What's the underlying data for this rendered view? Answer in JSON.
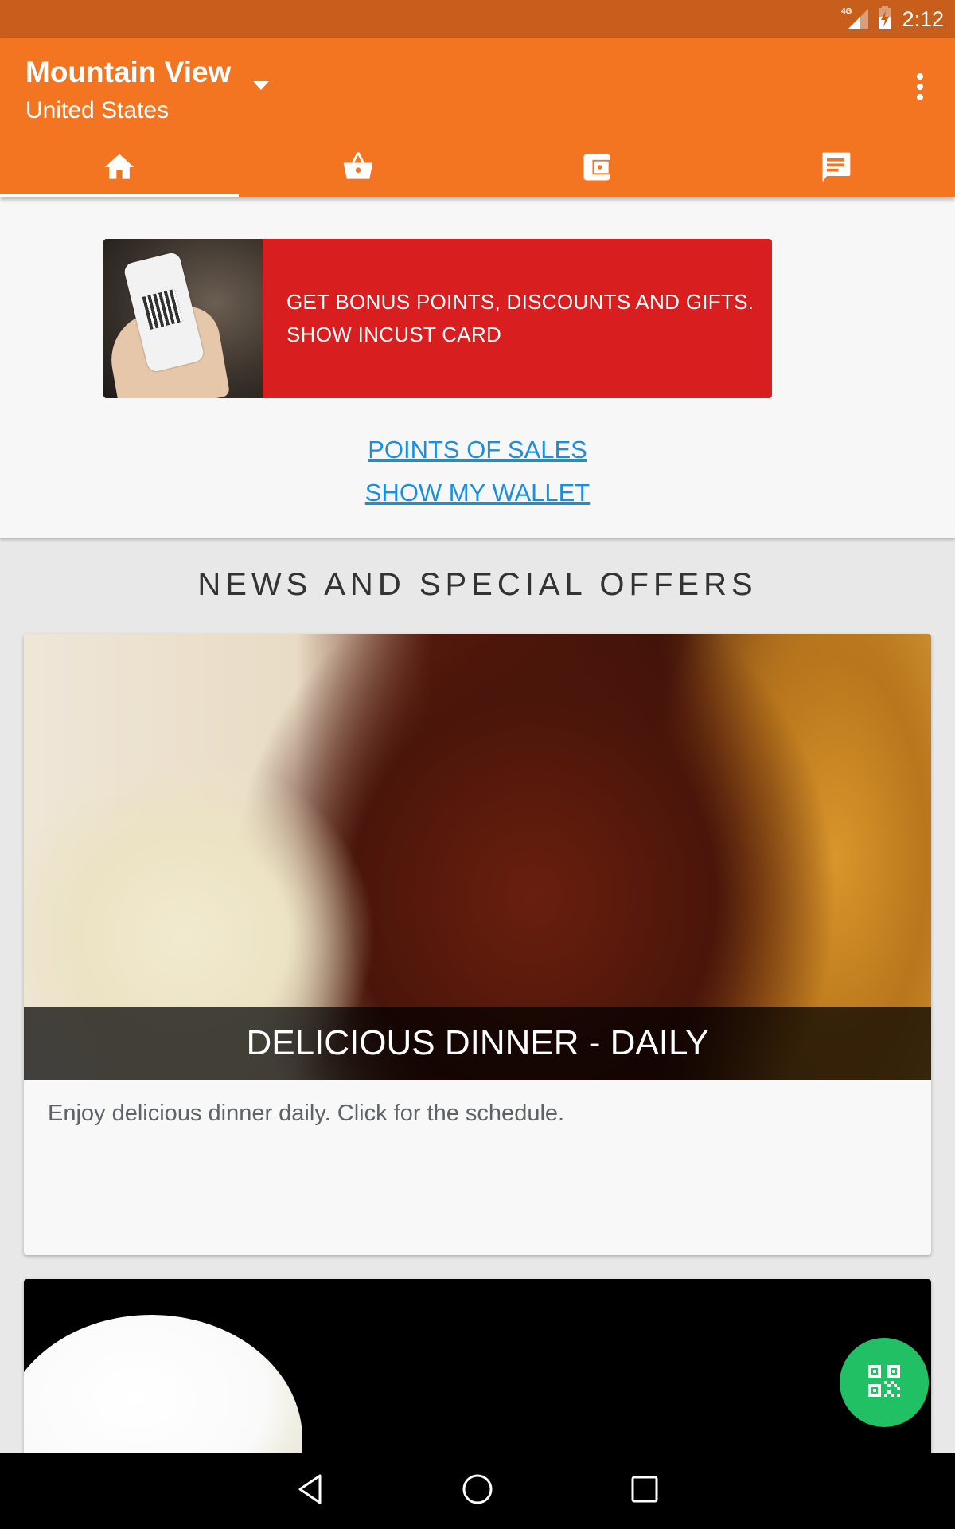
{
  "status_bar": {
    "network": "4G",
    "time": "2:12"
  },
  "app_bar": {
    "city": "Mountain View",
    "country": "United States",
    "colors": {
      "primary": "#f37421",
      "status": "#c75e1c"
    }
  },
  "tabs": [
    {
      "icon": "home-icon",
      "active": true
    },
    {
      "icon": "basket-icon",
      "active": false
    },
    {
      "icon": "wallet-icon",
      "active": false
    },
    {
      "icon": "chat-icon",
      "active": false
    }
  ],
  "banner": {
    "line1": "GET BONUS POINTS, DISCOUNTS AND GIFTS.",
    "line2": "SHOW INCUST CARD",
    "color": "#d81e1e"
  },
  "links": {
    "points_of_sales": "POINTS OF SALES",
    "show_wallet": "SHOW MY WALLET",
    "color": "#1a8fe0"
  },
  "news": {
    "title": "NEWS AND SPECIAL OFFERS",
    "items": [
      {
        "title": "DELICIOUS DINNER - DAILY",
        "description": "Enjoy delicious dinner daily. Click for the schedule."
      }
    ]
  },
  "fab": {
    "icon": "qr-code-icon",
    "color": "#22c064"
  },
  "nav_bar": {
    "buttons": [
      "back",
      "home",
      "recents"
    ]
  }
}
